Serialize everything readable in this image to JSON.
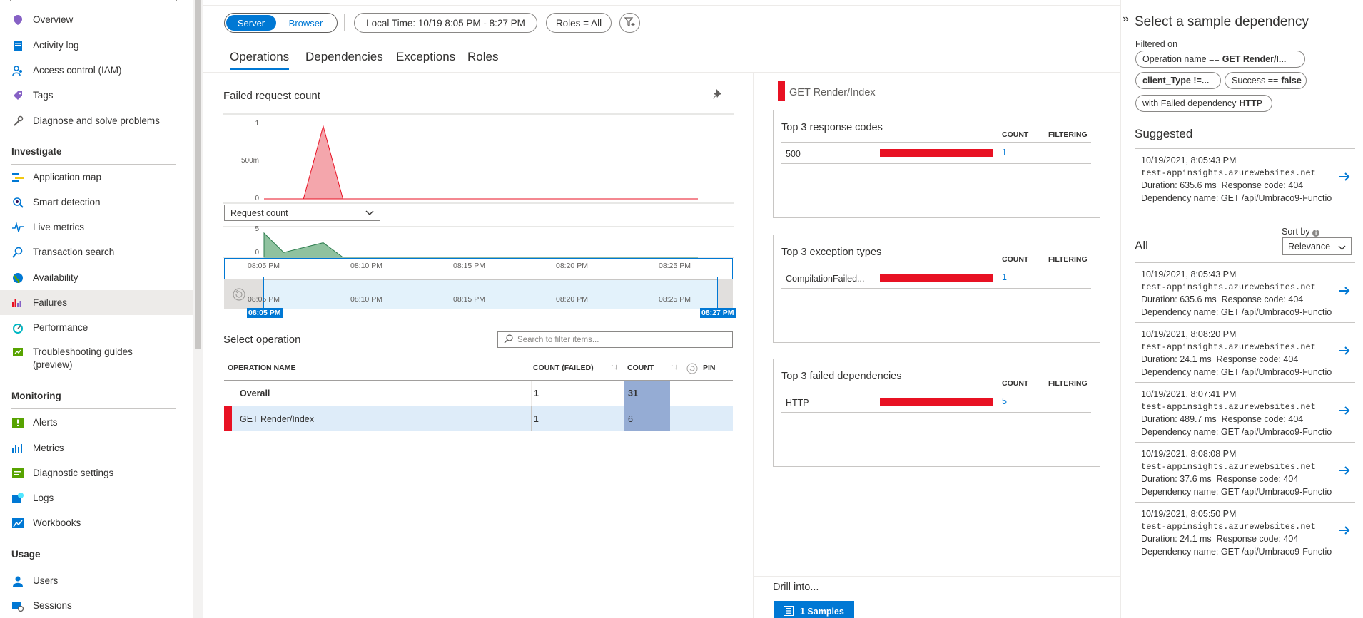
{
  "sidebar": {
    "items": [
      {
        "label": "Overview",
        "icon": "overview-icon"
      },
      {
        "label": "Activity log",
        "icon": "activity-log-icon"
      },
      {
        "label": "Access control (IAM)",
        "icon": "access-control-icon"
      },
      {
        "label": "Tags",
        "icon": "tag-icon"
      },
      {
        "label": "Diagnose and solve problems",
        "icon": "wrench-icon"
      }
    ],
    "sections": {
      "investigate": "Investigate",
      "monitoring": "Monitoring",
      "usage": "Usage"
    },
    "investigate_items": [
      {
        "label": "Application map",
        "icon": "application-map-icon"
      },
      {
        "label": "Smart detection",
        "icon": "smart-detection-icon"
      },
      {
        "label": "Live metrics",
        "icon": "live-metrics-icon"
      },
      {
        "label": "Transaction search",
        "icon": "search-icon"
      },
      {
        "label": "Availability",
        "icon": "globe-icon"
      },
      {
        "label": "Failures",
        "icon": "failures-icon"
      },
      {
        "label": "Performance",
        "icon": "performance-icon"
      },
      {
        "label": "Troubleshooting guides",
        "label2": "(preview)",
        "icon": "guide-icon"
      }
    ],
    "monitoring_items": [
      {
        "label": "Alerts",
        "icon": "alert-icon"
      },
      {
        "label": "Metrics",
        "icon": "metrics-icon"
      },
      {
        "label": "Diagnostic settings",
        "icon": "diagnostic-settings-icon"
      },
      {
        "label": "Logs",
        "icon": "logs-icon"
      },
      {
        "label": "Workbooks",
        "icon": "workbooks-icon"
      }
    ],
    "usage_items": [
      {
        "label": "Users",
        "icon": "users-icon"
      },
      {
        "label": "Sessions",
        "icon": "sessions-icon"
      }
    ]
  },
  "toolbar": {
    "server": "Server",
    "browser": "Browser",
    "time": "Local Time: 10/19 8:05 PM - 8:27 PM",
    "roles": "Roles = All"
  },
  "tabs": [
    "Operations",
    "Dependencies",
    "Exceptions",
    "Roles"
  ],
  "chart": {
    "title": "Failed request count",
    "yticks": [
      "1",
      "500m",
      "0"
    ],
    "dropdown": "Request count",
    "mini_yticks": [
      "5",
      "0"
    ],
    "xticks": [
      "08:05 PM",
      "08:10 PM",
      "08:15 PM",
      "08:20 PM",
      "08:25 PM"
    ],
    "range_start": "08:05 PM",
    "range_end": "08:27 PM"
  },
  "chart_data": [
    {
      "type": "area",
      "x": [
        "08:05 PM",
        "08:07 PM",
        "08:08 PM",
        "08:09 PM",
        "08:27 PM"
      ],
      "values": [
        0,
        0,
        1,
        0,
        0
      ],
      "ylim": [
        0,
        1
      ],
      "title": "Failed request count"
    },
    {
      "type": "area",
      "x": [
        "08:05 PM",
        "08:06 PM",
        "08:08 PM",
        "08:09 PM",
        "08:27 PM"
      ],
      "values": [
        5,
        1,
        3,
        0,
        0
      ],
      "ylim": [
        0,
        5
      ],
      "title": "Request count"
    }
  ],
  "operations": {
    "title": "Select operation",
    "search_placeholder": "Search to filter items...",
    "headers": {
      "name": "OPERATION NAME",
      "failed": "COUNT (FAILED)",
      "count": "COUNT",
      "pin": "PIN"
    },
    "rows": [
      {
        "name": "Overall",
        "failed": "1",
        "count": "31"
      },
      {
        "name": "GET Render/Index",
        "failed": "1",
        "count": "6"
      }
    ]
  },
  "details": {
    "selected": "GET Render/Index",
    "count_hdr": "COUNT",
    "filter_hdr": "FILTERING",
    "cards": [
      {
        "title": "Top 3 response codes",
        "name": "500",
        "count": "1"
      },
      {
        "title": "Top 3 exception types",
        "name": "CompilationFailed...",
        "count": "1"
      },
      {
        "title": "Top 3 failed dependencies",
        "name": "HTTP",
        "count": "5"
      }
    ],
    "drill": "Drill into...",
    "samples_btn": "1 Samples"
  },
  "panel": {
    "title": "Select a sample dependency",
    "filtered_on": "Filtered on",
    "chips": [
      {
        "key": "Operation name ==",
        "value": "GET Render/I..."
      },
      {
        "key": "",
        "value": "client_Type !=..."
      },
      {
        "key": "Success ==",
        "value": "false"
      },
      {
        "key": "with Failed dependency",
        "value": "HTTP"
      }
    ],
    "suggested": "Suggested",
    "all": "All",
    "sort_by": "Sort by",
    "sort_value": "Relevance",
    "suggested_samples": [
      {
        "time": "10/19/2021, 8:05:43 PM",
        "host": "test-appinsights.azurewebsites.net",
        "duration": "Duration: 635.6 ms",
        "code": "Response code: 404",
        "dep": "Dependency name: GET /api/Umbraco9-Functio"
      }
    ],
    "samples": [
      {
        "time": "10/19/2021, 8:05:43 PM",
        "host": "test-appinsights.azurewebsites.net",
        "duration": "Duration: 635.6 ms",
        "code": "Response code: 404",
        "dep": "Dependency name: GET /api/Umbraco9-Functio"
      },
      {
        "time": "10/19/2021, 8:08:20 PM",
        "host": "test-appinsights.azurewebsites.net",
        "duration": "Duration: 24.1 ms",
        "code": "Response code: 404",
        "dep": "Dependency name: GET /api/Umbraco9-Functio"
      },
      {
        "time": "10/19/2021, 8:07:41 PM",
        "host": "test-appinsights.azurewebsites.net",
        "duration": "Duration: 489.7 ms",
        "code": "Response code: 404",
        "dep": "Dependency name: GET /api/Umbraco9-Functio"
      },
      {
        "time": "10/19/2021, 8:08:08 PM",
        "host": "test-appinsights.azurewebsites.net",
        "duration": "Duration: 37.6 ms",
        "code": "Response code: 404",
        "dep": "Dependency name: GET /api/Umbraco9-Functio"
      },
      {
        "time": "10/19/2021, 8:05:50 PM",
        "host": "test-appinsights.azurewebsites.net",
        "duration": "Duration: 24.1 ms",
        "code": "Response code: 404",
        "dep": "Dependency name: GET /api/Umbraco9-Functio"
      }
    ]
  }
}
